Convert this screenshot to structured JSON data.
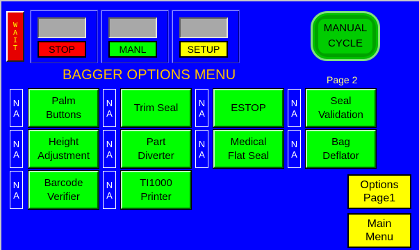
{
  "wait_indicator": {
    "label": "WAIT"
  },
  "modes": [
    {
      "label": "STOP"
    },
    {
      "label": "MANL"
    },
    {
      "label": "SETUP"
    }
  ],
  "manual_cycle": {
    "line1": "MANUAL",
    "line2": "CYCLE"
  },
  "title": "BAGGER OPTIONS MENU",
  "page_label": "Page 2",
  "na_label": {
    "line1": "N",
    "line2": "A"
  },
  "options": [
    {
      "label": "Palm\nButtons"
    },
    {
      "label": "Trim Seal"
    },
    {
      "label": "ESTOP"
    },
    {
      "label": "Seal\nValidation"
    },
    {
      "label": "Height\nAdjustment"
    },
    {
      "label": "Part\nDiverter"
    },
    {
      "label": "Medical\nFlat Seal"
    },
    {
      "label": "Bag\nDeflator"
    },
    {
      "label": "Barcode\nVerifier"
    },
    {
      "label": "TI1000\nPrinter"
    }
  ],
  "nav": {
    "options_page1": "Options\nPage1",
    "main_menu": "Main\nMenu"
  },
  "colors": {
    "background": "#0000ff",
    "option_button": "#00ff00",
    "nav_button": "#ffff00",
    "title": "#ffc000"
  }
}
